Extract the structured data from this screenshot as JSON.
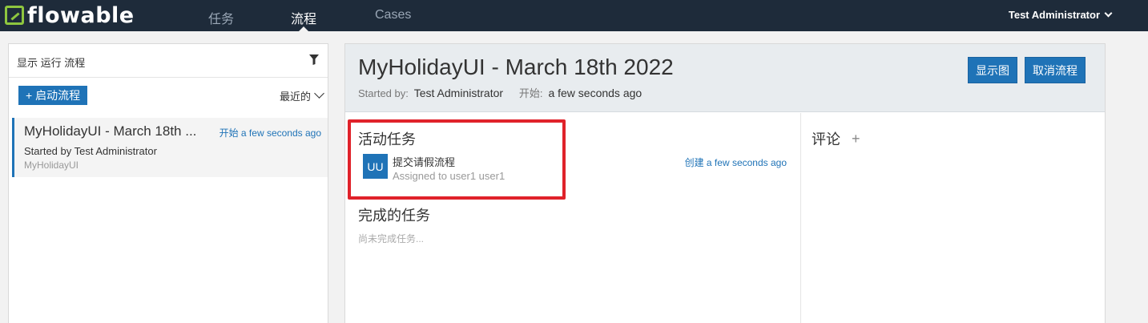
{
  "app": {
    "logo_text": "flowable",
    "brand_color": "#8ec63f",
    "nav_bg": "#1e2b3a",
    "accent": "#1f73b7"
  },
  "nav": {
    "tabs": [
      {
        "label": "任务"
      },
      {
        "label": "流程"
      },
      {
        "label": "Cases"
      }
    ],
    "active": "流程"
  },
  "user": {
    "name": "Test Administrator"
  },
  "left_panel": {
    "filter_title": "显示 运行 流程",
    "start_button": "+ 启动流程",
    "sort_label": "最近的",
    "process_list": [
      {
        "name": "MyHolidayUI - March 18th ...",
        "time": "开始 a few seconds ago",
        "started_by": "Started by Test Administrator",
        "definition": "MyHolidayUI"
      }
    ]
  },
  "process": {
    "title": "MyHolidayUI - March 18th 2022",
    "started_by_label": "Started by:",
    "started_by_value": "Test Administrator",
    "start_label": "开始:",
    "start_value": "a few seconds ago",
    "show_diagram_button": "显示图",
    "cancel_button": "取消流程"
  },
  "active_tasks": {
    "heading": "活动任务",
    "tasks": [
      {
        "avatar": "UU",
        "name": "提交请假流程",
        "assignee": "Assigned to user1 user1",
        "created": "创建 a few seconds ago"
      }
    ]
  },
  "completed_tasks": {
    "heading": "完成的任务",
    "empty_text": "尚未完成任务..."
  },
  "comments": {
    "heading": "评论",
    "add_symbol": "+"
  },
  "icons": {
    "filter": "filter-icon",
    "user_dropdown": "chevron-down-icon",
    "sort_dropdown": "chevron-down-icon"
  },
  "highlight_color": "#e0222a"
}
